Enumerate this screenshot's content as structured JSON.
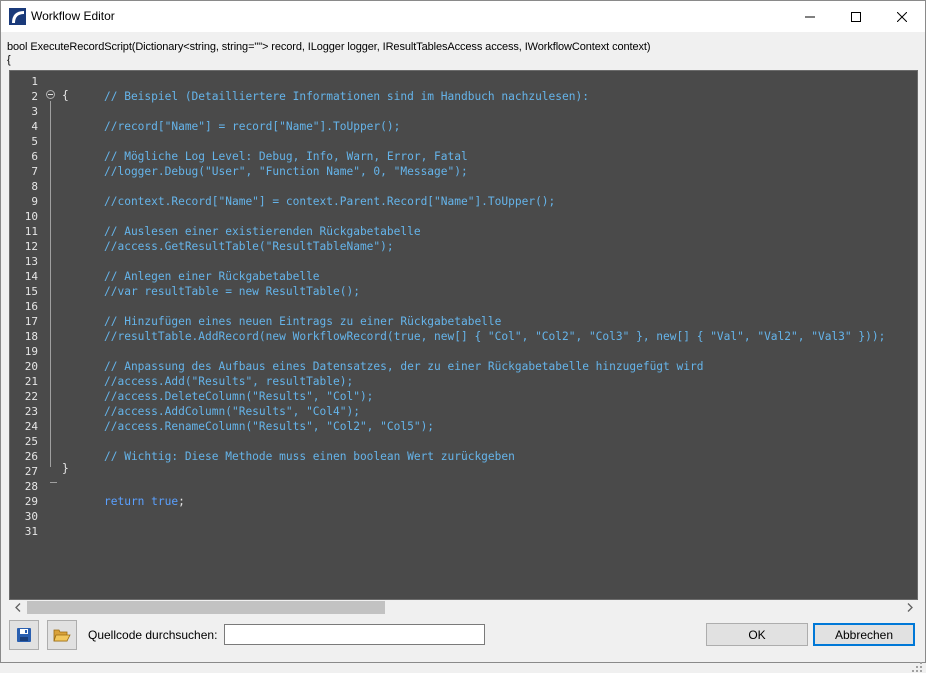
{
  "window": {
    "title": "Workflow Editor",
    "icon": "app-icon",
    "controls": [
      "minimize-icon",
      "maximize-icon",
      "close-icon"
    ]
  },
  "signature": {
    "line1": "bool ExecuteRecordScript(Dictionary<string, string=\"\"> record, ILogger logger, IResultTablesAccess access, IWorkflowContext context)",
    "line2": "{"
  },
  "editor": {
    "colors": {
      "background": "#4a4a4a",
      "comment": "#65b4ea",
      "keyword": "#5aa0ff",
      "text": "#e6e6e6"
    },
    "line_numbers": [
      "1",
      "2",
      "3",
      "4",
      "5",
      "6",
      "7",
      "8",
      "9",
      "10",
      "11",
      "12",
      "13",
      "14",
      "15",
      "16",
      "17",
      "18",
      "19",
      "20",
      "21",
      "22",
      "23",
      "24",
      "25",
      "26",
      "27",
      "28",
      "29",
      "30",
      "31"
    ],
    "brace_open": "{",
    "brace_close": "}",
    "lines": [
      {
        "n": 2,
        "text": "// Beispiel (Detailliertere Informationen sind im Handbuch nachzulesen):",
        "kind": "cmt"
      },
      {
        "n": 4,
        "text": "//record[\"Name\"] = record[\"Name\"].ToUpper();",
        "kind": "cmt"
      },
      {
        "n": 6,
        "text": "// Mögliche Log Level: Debug, Info, Warn, Error, Fatal",
        "kind": "cmt"
      },
      {
        "n": 7,
        "text": "//logger.Debug(\"User\", \"Function Name\", 0, \"Message\");",
        "kind": "cmt"
      },
      {
        "n": 9,
        "text": "//context.Record[\"Name\"] = context.Parent.Record[\"Name\"].ToUpper();",
        "kind": "cmt"
      },
      {
        "n": 11,
        "text": "// Auslesen einer existierenden Rückgabetabelle",
        "kind": "cmt"
      },
      {
        "n": 12,
        "text": "//access.GetResultTable(\"ResultTableName\");",
        "kind": "cmt"
      },
      {
        "n": 14,
        "text": "// Anlegen einer Rückgabetabelle",
        "kind": "cmt"
      },
      {
        "n": 15,
        "text": "//var resultTable = new ResultTable();",
        "kind": "cmt"
      },
      {
        "n": 17,
        "text": "// Hinzufügen eines neuen Eintrags zu einer Rückgabetabelle",
        "kind": "cmt"
      },
      {
        "n": 18,
        "text": "//resultTable.AddRecord(new WorkflowRecord(true, new[] { \"Col\", \"Col2\", \"Col3\" }, new[] { \"Val\", \"Val2\", \"Val3\" }));",
        "kind": "cmt"
      },
      {
        "n": 20,
        "text": "// Anpassung des Aufbaus eines Datensatzes, der zu einer Rückgabetabelle hinzugefügt wird",
        "kind": "cmt"
      },
      {
        "n": 21,
        "text": "//access.Add(\"Results\", resultTable);",
        "kind": "cmt"
      },
      {
        "n": 22,
        "text": "//access.DeleteColumn(\"Results\", \"Col\");",
        "kind": "cmt"
      },
      {
        "n": 23,
        "text": "//access.AddColumn(\"Results\", \"Col4\");",
        "kind": "cmt"
      },
      {
        "n": 24,
        "text": "//access.RenameColumn(\"Results\", \"Col2\", \"Col5\");",
        "kind": "cmt"
      },
      {
        "n": 26,
        "text": "// Wichtig: Diese Methode muss einen boolean Wert zurückgeben",
        "kind": "cmt"
      }
    ],
    "return_line": {
      "n": 29,
      "keyword1": "return",
      "keyword2": "true",
      "suffix": ";"
    }
  },
  "scrollbar": {
    "thumb_fraction": 0.41
  },
  "bottom": {
    "save_icon": "save-icon",
    "open_icon": "folder-open-icon",
    "search_label": "Quellcode durchsuchen:",
    "search_value": "",
    "ok_label": "OK",
    "cancel_label": "Abbrechen"
  }
}
